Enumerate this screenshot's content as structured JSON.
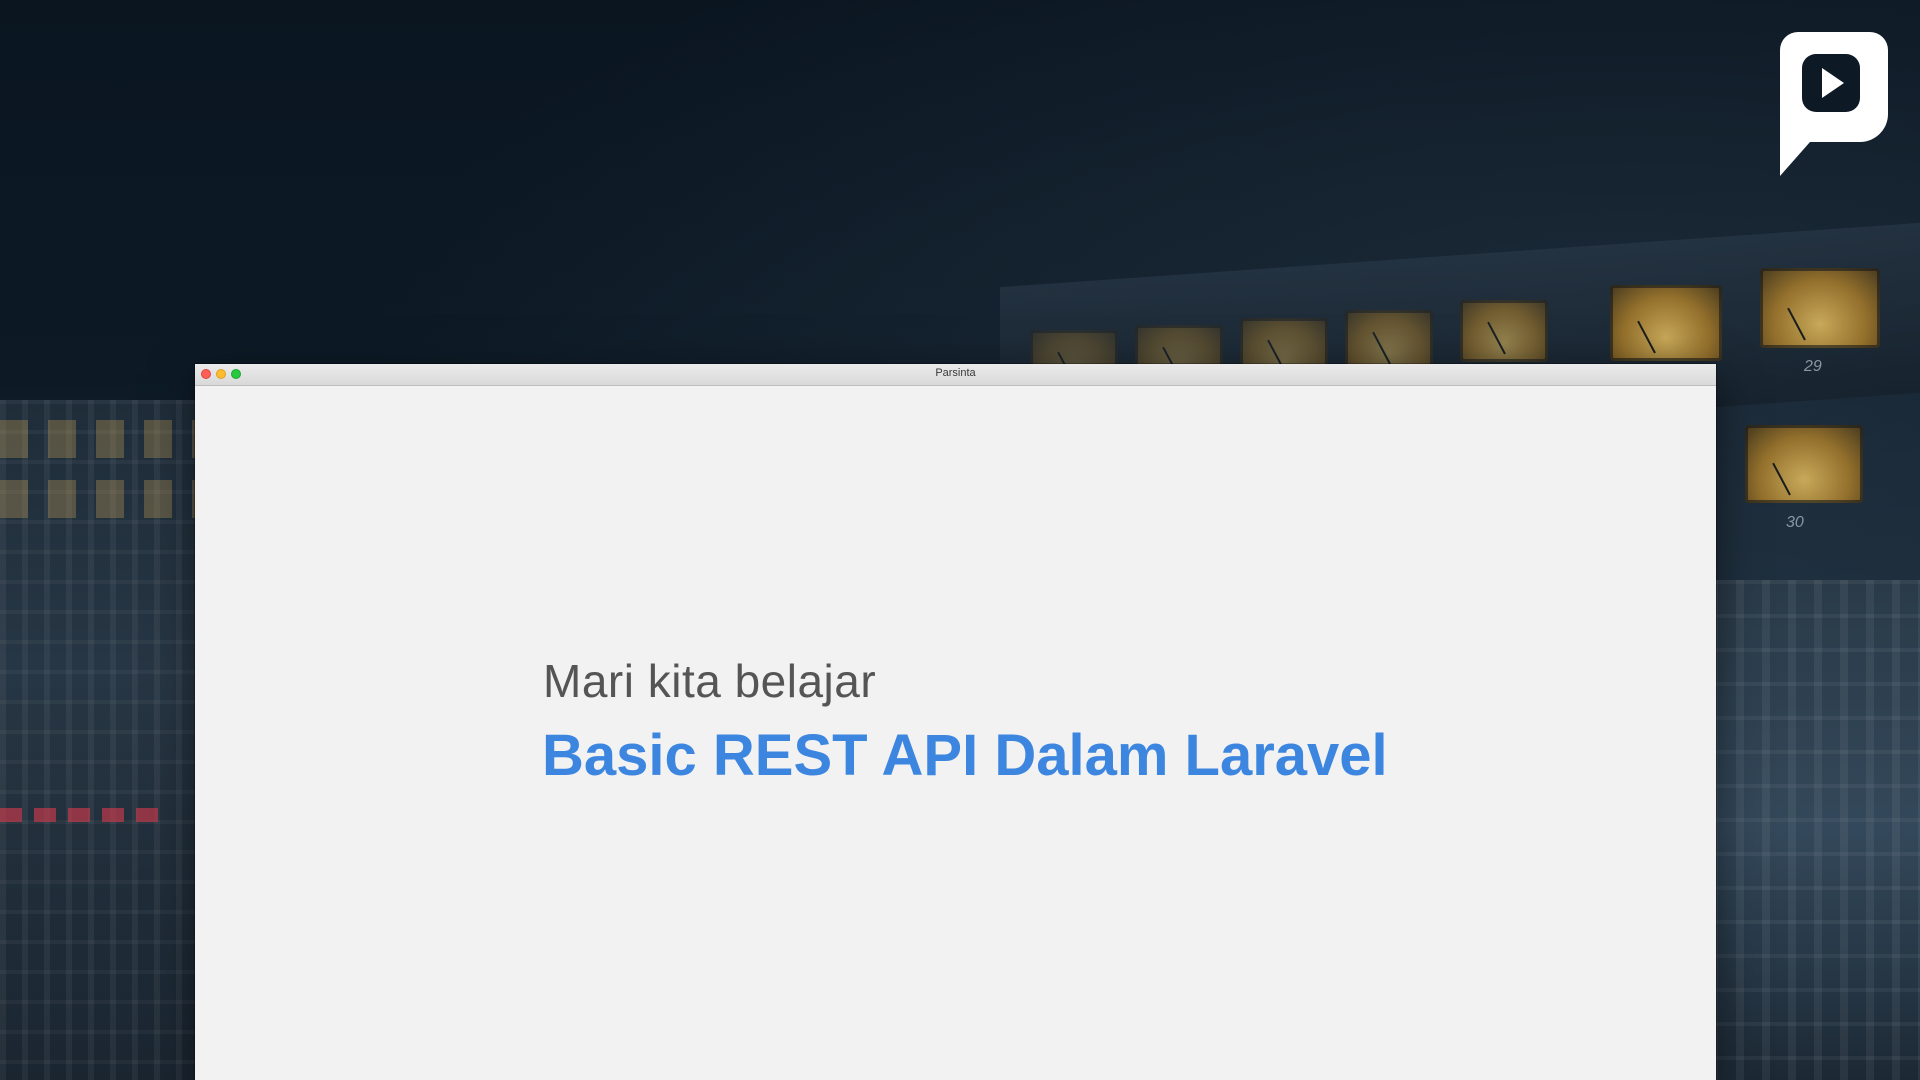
{
  "window": {
    "title": "Parsinta"
  },
  "slide": {
    "intro": "Mari kita belajar",
    "headline": "Basic REST API Dalam Laravel"
  },
  "background": {
    "channel_numbers": [
      "29",
      "30"
    ]
  },
  "logo": {
    "icon": "play-icon"
  },
  "colors": {
    "headline": "#3d86e0",
    "intro": "#555555",
    "window_bg": "#f2f2f2",
    "traffic_close": "#ff5f57",
    "traffic_minimize": "#febc2e",
    "traffic_maximize": "#28c840"
  }
}
